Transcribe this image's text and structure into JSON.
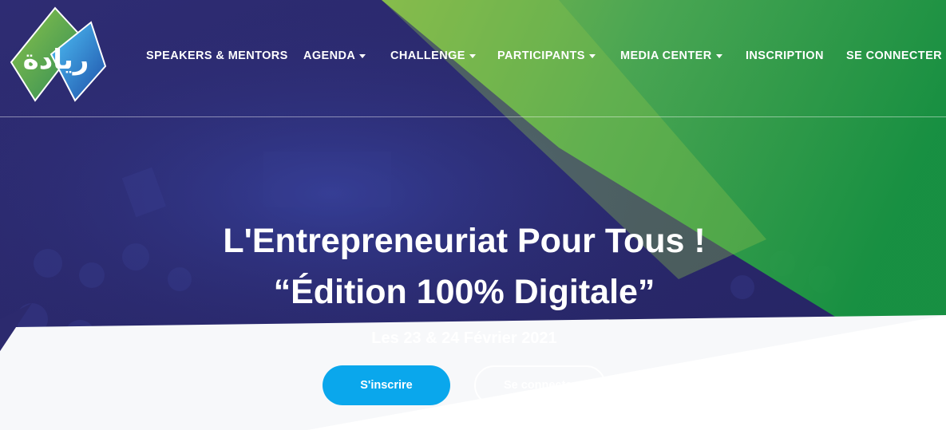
{
  "brand": {
    "logo_label": "ريادة",
    "colors": {
      "navy": "#2c2a6e",
      "green": "#1e9a46",
      "light_green": "#7cb342",
      "button_blue": "#0aa7ec"
    }
  },
  "nav": {
    "items": [
      {
        "label": "SPEAKERS & MENTORS",
        "has_dropdown": false
      },
      {
        "label": "AGENDA",
        "has_dropdown": true
      },
      {
        "label": "CHALLENGE",
        "has_dropdown": true
      },
      {
        "label": "PARTICIPANTS",
        "has_dropdown": true
      },
      {
        "label": "MEDIA CENTER",
        "has_dropdown": true
      },
      {
        "label": "INSCRIPTION",
        "has_dropdown": false
      },
      {
        "label": "SE CONNECTER",
        "has_dropdown": false
      }
    ]
  },
  "hero": {
    "title_line1": "L'Entrepreneuriat Pour Tous !",
    "title_line2": "“Édition 100% Digitale”",
    "date": "Les 23 & 24 Février 2021",
    "primary_button": "S'inscrire",
    "secondary_button": "Se connecter"
  }
}
